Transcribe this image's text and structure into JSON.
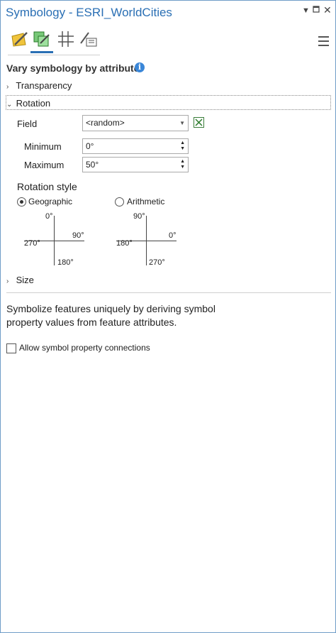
{
  "window": {
    "title": "Symbology - ESRI_WorldCities"
  },
  "heading": {
    "text": "Vary symbology by attribute"
  },
  "sections": {
    "transparency": "Transparency",
    "rotation": "Rotation",
    "size": "Size"
  },
  "rotation": {
    "field_label": "Field",
    "field_value": "<random>",
    "minimum_label": "Minimum",
    "minimum_value": "0°",
    "maximum_label": "Maximum",
    "maximum_value": "50°",
    "style_label": "Rotation style",
    "geographic_label": "Geographic",
    "arithmetic_label": "Arithmetic",
    "selected_style": "Geographic",
    "geographic_dial": {
      "top": "0°",
      "right": "90°",
      "bottom": "180°",
      "left": "270°"
    },
    "arithmetic_dial": {
      "top": "90°",
      "right": "0°",
      "bottom": "270°",
      "left": "180°"
    }
  },
  "description": "Symbolize features uniquely by deriving symbol property values from feature attributes.",
  "allow_connections": {
    "label": "Allow symbol property connections",
    "checked": false
  },
  "colors": {
    "accent": "#2a6fb4",
    "info": "#3b87d8"
  },
  "icons": {
    "tabs": [
      "primary-symbology-icon",
      "vary-by-attribute-icon",
      "symbol-layer-drawing-icon",
      "advanced-symbology-icon"
    ],
    "menu": "hamburger-menu-icon"
  }
}
